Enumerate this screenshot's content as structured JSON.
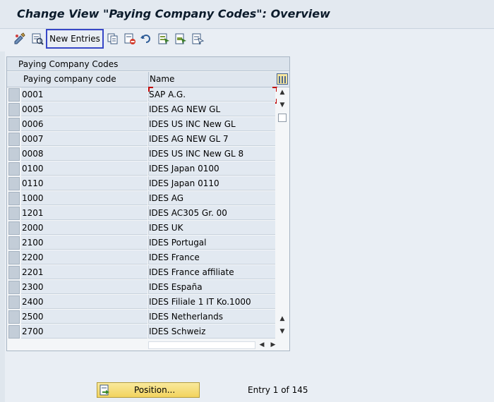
{
  "window": {
    "title": "Change View \"Paying Company Codes\": Overview"
  },
  "toolbar": {
    "new_entries_label": "New Entries",
    "icons": [
      "display-change-icon",
      "details-icon",
      "copy-as-icon",
      "delete-icon",
      "undo-change-icon",
      "select-all-icon",
      "select-block-icon",
      "deselect-all-icon"
    ]
  },
  "table": {
    "title": "Paying Company Codes",
    "columns": [
      "Paying company code",
      "Name"
    ],
    "rows": [
      {
        "code": "0001",
        "name": "SAP A.G."
      },
      {
        "code": "0005",
        "name": "IDES AG NEW GL"
      },
      {
        "code": "0006",
        "name": "IDES US INC New GL"
      },
      {
        "code": "0007",
        "name": "IDES AG NEW GL 7"
      },
      {
        "code": "0008",
        "name": "IDES US INC New GL 8"
      },
      {
        "code": "0100",
        "name": "IDES Japan 0100"
      },
      {
        "code": "0110",
        "name": "IDES Japan 0110"
      },
      {
        "code": "1000",
        "name": "IDES AG"
      },
      {
        "code": "1201",
        "name": "IDES AC305 Gr. 00"
      },
      {
        "code": "2000",
        "name": "IDES UK"
      },
      {
        "code": "2100",
        "name": "IDES Portugal"
      },
      {
        "code": "2200",
        "name": "IDES France"
      },
      {
        "code": "2201",
        "name": "IDES France affiliate"
      },
      {
        "code": "2300",
        "name": "IDES España"
      },
      {
        "code": "2400",
        "name": "IDES Filiale 1 IT Ko.1000"
      },
      {
        "code": "2500",
        "name": "IDES Netherlands"
      },
      {
        "code": "2700",
        "name": "IDES Schweiz"
      }
    ]
  },
  "footer": {
    "position_label": "Position...",
    "entry_info": "Entry 1 of 145"
  },
  "colors": {
    "accent_border": "#3747c7",
    "button_yellow": "#f2d35e",
    "cell_bg": "#e2e9f1",
    "focus_marker": "#c00000"
  }
}
